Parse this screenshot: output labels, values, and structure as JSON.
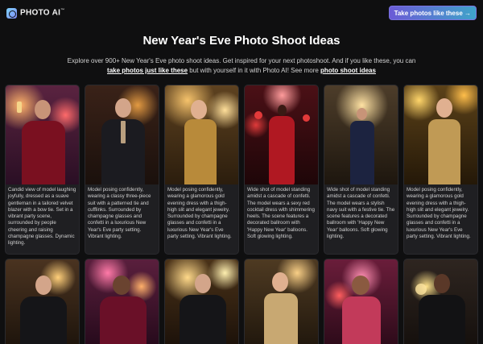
{
  "brand": {
    "name": "PHOTO AI",
    "tm": "™"
  },
  "header": {
    "cta_label": "Take photos like these →"
  },
  "page": {
    "title": "New Year's Eve Photo Shoot Ideas",
    "desc_line1": "Explore over 900+ New Year's Eve photo shoot ideas. Get inspired for your next photoshoot. And if you like these, you can",
    "desc_link1": "take photos just like these",
    "desc_mid": " but with yourself in it with Photo AI! See more ",
    "desc_link2": "photo shoot ideas"
  },
  "cards": [
    {
      "caption": "Candid view of model laughing joyfully, dressed as a suave gentleman in a tailored velvet blazer with a bow tie. Set in a vibrant party scene, surrounded by people cheering and raising champagne glasses. Dynamic lighting."
    },
    {
      "caption": "Model posing confidently, wearing a classy three-piece suit with a patterned tie and cufflinks. Surrounded by champagne glasses and confetti in a luxurious New Year's Eve party setting. Vibrant lighting."
    },
    {
      "caption": "Model posing confidently, wearing a glamorous gold evening dress with a thigh-high slit and elegant jewelry. Surrounded by champagne glasses and confetti in a luxurious New Year's Eve party setting. Vibrant lighting."
    },
    {
      "caption": "Wide shot of model standing amidst a cascade of confetti. The model wears a sexy red cocktail dress with shimmering heels. The scene features a decorated ballroom with 'Happy New Year' balloons. Soft glowing lighting."
    },
    {
      "caption": "Wide shot of model standing amidst a cascade of confetti. The model wears a stylish navy suit with a festive tie. The scene features a decorated ballroom with 'Happy New Year' balloons. Soft glowing lighting."
    },
    {
      "caption": "Model posing confidently, wearing a glamorous gold evening dress with a thigh-high slit and elegant jewelry. Surrounded by champagne glasses and confetti in a luxurious New Year's Eve party setting. Vibrant lighting."
    }
  ]
}
